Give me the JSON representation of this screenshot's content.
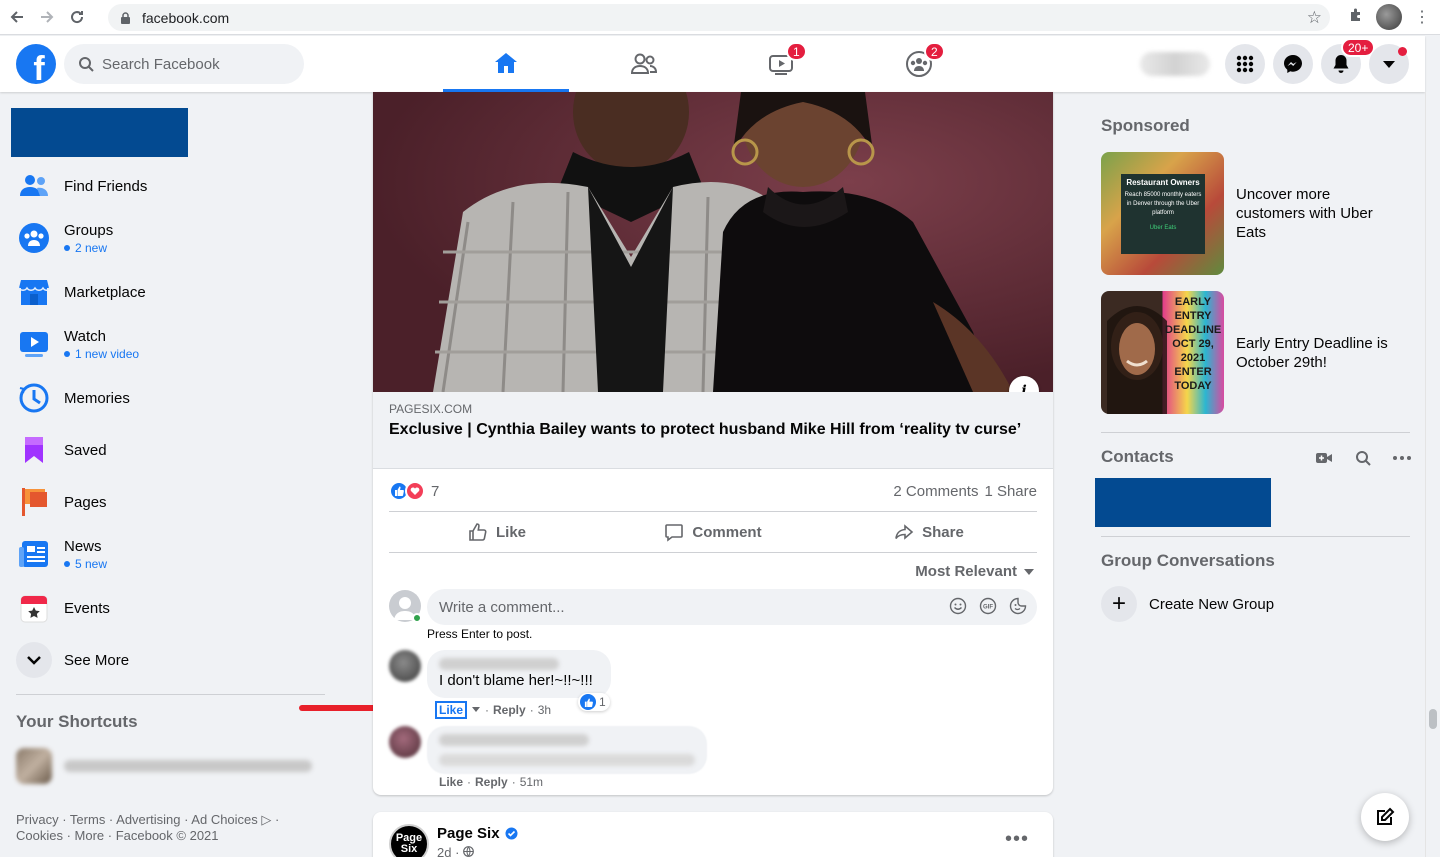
{
  "browser": {
    "url": "facebook.com"
  },
  "header": {
    "search_placeholder": "Search Facebook",
    "watch_badge": "1",
    "groups_badge": "2",
    "notifications_badge": "20+"
  },
  "sidebar": {
    "items": [
      {
        "label": "Find Friends",
        "sub": ""
      },
      {
        "label": "Groups",
        "sub": "2 new"
      },
      {
        "label": "Marketplace",
        "sub": ""
      },
      {
        "label": "Watch",
        "sub": "1 new video"
      },
      {
        "label": "Memories",
        "sub": ""
      },
      {
        "label": "Saved",
        "sub": ""
      },
      {
        "label": "Pages",
        "sub": ""
      },
      {
        "label": "News",
        "sub": "5 new"
      },
      {
        "label": "Events",
        "sub": ""
      }
    ],
    "see_more": "See More",
    "shortcuts_title": "Your Shortcuts",
    "footer": "Privacy · Terms · Advertising · Ad Choices ▷ · Cookies · More · Facebook © 2021"
  },
  "post": {
    "link_domain": "PAGESIX.COM",
    "link_title": "Exclusive | Cynthia Bailey wants to protect husband Mike Hill from ‘reality tv curse’",
    "reaction_count": "7",
    "comments_count": "2 Comments",
    "shares_count": "1 Share",
    "like_label": "Like",
    "comment_label": "Comment",
    "share_label": "Share",
    "sort_label": "Most Relevant",
    "write_placeholder": "Write a comment...",
    "press_enter": "Press Enter to post.",
    "comments": [
      {
        "text": "I don't blame her!~!!~!!!",
        "like": "Like",
        "reply": "Reply",
        "time": "3h",
        "likes": "1"
      },
      {
        "like": "Like",
        "reply": "Reply",
        "time": "51m"
      }
    ]
  },
  "post2": {
    "page_name": "Page Six",
    "logo_text": "Page Six",
    "time": "2d ·",
    "more": "•••"
  },
  "right": {
    "sponsored_title": "Sponsored",
    "ads": [
      {
        "text": "Uncover more customers with Uber Eats",
        "img_caption": "Restaurant Owners",
        "img_sub": "Reach 85000 monthly eaters in Denver through the Uber platform",
        "img_brand": "Uber Eats"
      },
      {
        "text": "Early Entry Deadline is October 29th!",
        "img_caption": "EARLY ENTRY DEADLINE OCT 29, 2021 ENTER TODAY"
      }
    ],
    "contacts_title": "Contacts",
    "group_conv_title": "Group Conversations",
    "create_group": "Create New Group"
  },
  "colors": {
    "accent": "#1877f2",
    "redaction": "#034a91",
    "annotation_arrow": "#e8202a"
  }
}
